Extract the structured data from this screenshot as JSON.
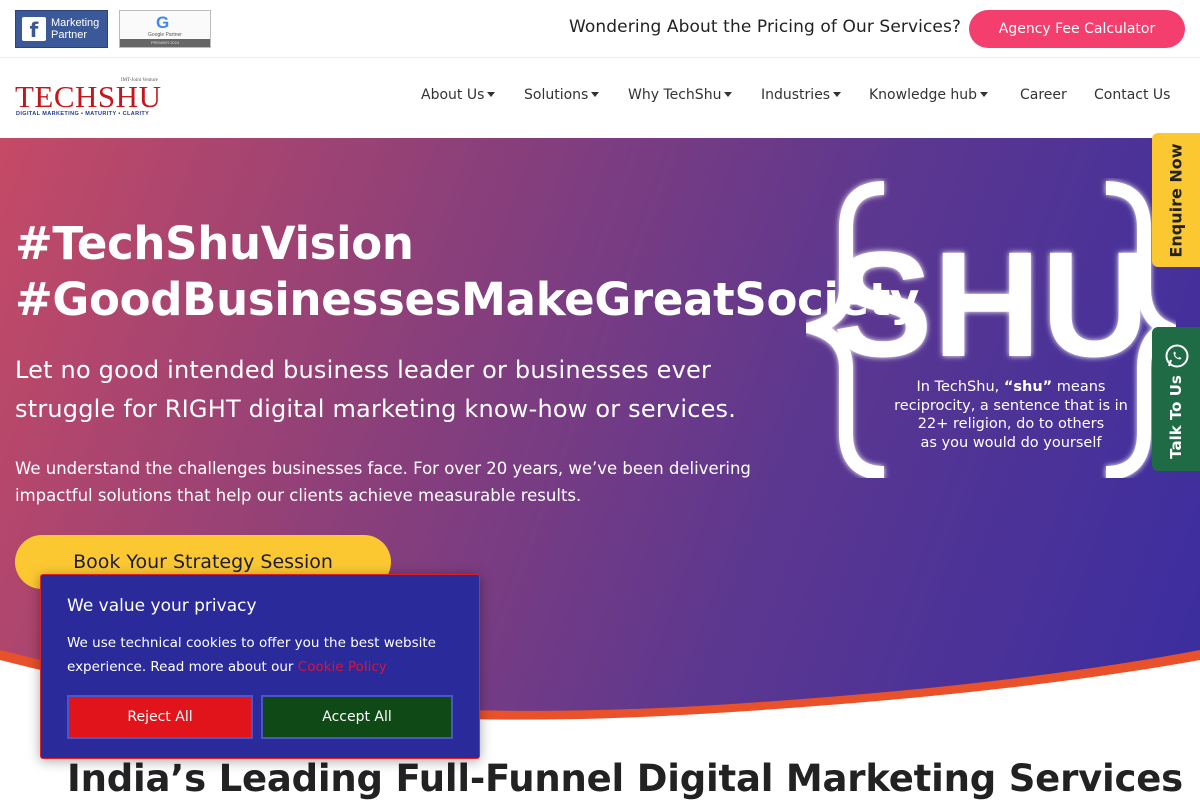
{
  "topbar": {
    "fb_badge": {
      "icon": "facebook-f-icon",
      "line1": "Marketing",
      "line2": "Partner"
    },
    "google_badge": {
      "mark": "G",
      "sub": "Google Partner",
      "strip": "PREMIER 2024"
    },
    "pricing_question": "Wondering About the Pricing of Our Services?",
    "fee_button": "Agency Fee Calculator"
  },
  "logo": {
    "name": "TECHSHU",
    "tagline": "DIGITAL MARKETING • MATURITY • CLARITY",
    "venture": "IMT-Joint Venture"
  },
  "nav": {
    "items": [
      {
        "label": "About Us",
        "dropdown": true
      },
      {
        "label": "Solutions",
        "dropdown": true
      },
      {
        "label": "Why TechShu",
        "dropdown": true
      },
      {
        "label": "Industries",
        "dropdown": true
      },
      {
        "label": "Knowledge hub",
        "dropdown": true
      },
      {
        "label": "Career",
        "dropdown": false
      },
      {
        "label": "Contact Us",
        "dropdown": false
      }
    ]
  },
  "hero": {
    "heading_line1": "#TechShuVision",
    "heading_line2": "#GoodBusinessesMakeGreatSociety",
    "lead": "Let no good intended business leader or businesses ever struggle for RIGHT digital marketing know-how or services.",
    "sub": "We understand the challenges businesses face. For over 20 years, we’ve been delivering impactful solutions that help our clients achieve measurable results.",
    "cta": "Book Your Strategy Session",
    "shu_word": "SHU",
    "shu_line1_pre": "In TechShu, ",
    "shu_line1_bold": "“shu”",
    "shu_line1_post": " means",
    "shu_line2": "reciprocity, a sentence that is in",
    "shu_line3": "22+ religion, do to others",
    "shu_line4": "as you would do yourself"
  },
  "side_tabs": {
    "enquire": "Enquire Now",
    "talk": "Talk To Us",
    "talk_icon": "whatsapp-icon"
  },
  "section": {
    "heading": "India’s Leading Full-Funnel Digital Marketing Services"
  },
  "cookie": {
    "title": "We value your privacy",
    "body": "We use technical cookies to offer you the best website experience. Read more about our",
    "link": "Cookie Policy",
    "reject": "Reject All",
    "accept": "Accept All"
  },
  "colors": {
    "accent_pink": "#f43f6e",
    "brand_red": "#c4161c",
    "cta_yellow": "#fcc832",
    "talk_green": "#1e6b45",
    "cookie_bg": "#2a2a9a",
    "reject_red": "#e0141a",
    "accept_green": "#0f4a16"
  }
}
